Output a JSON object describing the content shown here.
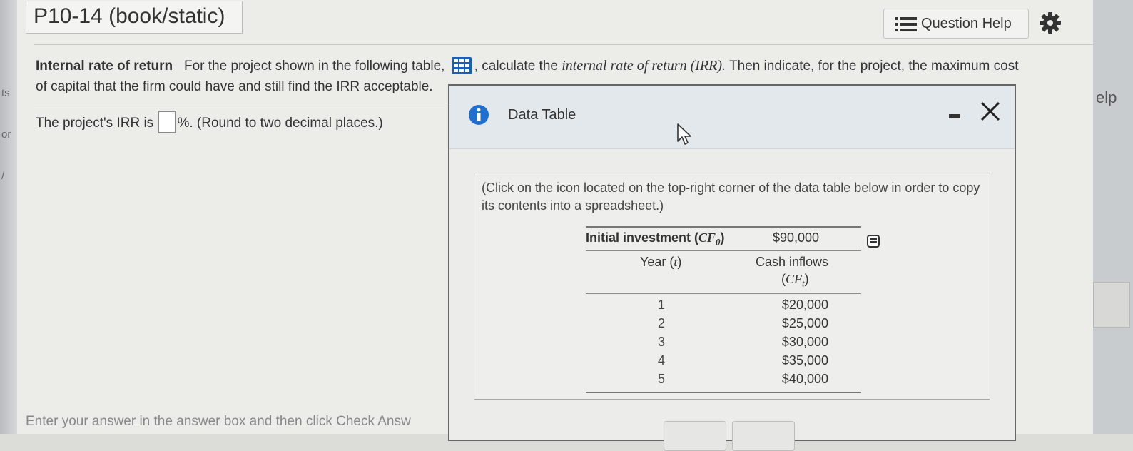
{
  "left_strip": {
    "fragments": [
      "ts",
      "or",
      "/"
    ]
  },
  "right_strip": {
    "fragment": "elp"
  },
  "header": {
    "title": "P10-14 (book/static)",
    "question_help_label": "Question Help"
  },
  "question": {
    "topic": "Internal rate of return",
    "text_before_icon": "For the project shown in the following table,",
    "text_after_icon": ", calculate the",
    "irr_term": "internal rate of return (IRR).",
    "text_end_line1": "Then indicate, for the project, the maximum cost",
    "text_line2": "of capital that the firm could have and still find the IRR acceptable."
  },
  "answer": {
    "prefix": "The project's IRR is",
    "suffix": "%. (Round to two decimal places.)",
    "value": ""
  },
  "footer": {
    "text": "Enter your answer in the answer box and then click Check Answ"
  },
  "modal": {
    "title": "Data Table",
    "instructions": "(Click on the icon located on the top-right corner of the data table below in order to copy its contents into a spreadsheet.)",
    "table": {
      "initial_label": "Initial investment (",
      "initial_var": "CF",
      "initial_sub": "0",
      "initial_value": "$90,000",
      "year_label": "Year (",
      "year_var": "t",
      "cash_label": "Cash inflows",
      "cash_var": "CF",
      "cash_sub": "t",
      "rows": [
        {
          "year": "1",
          "cash": "$20,000"
        },
        {
          "year": "2",
          "cash": "$25,000"
        },
        {
          "year": "3",
          "cash": "$30,000"
        },
        {
          "year": "4",
          "cash": "$35,000"
        },
        {
          "year": "5",
          "cash": "$40,000"
        }
      ]
    }
  },
  "colors": {
    "info_blue": "#1e6fd0",
    "grid_icon_blue": "#1a5fb4"
  }
}
